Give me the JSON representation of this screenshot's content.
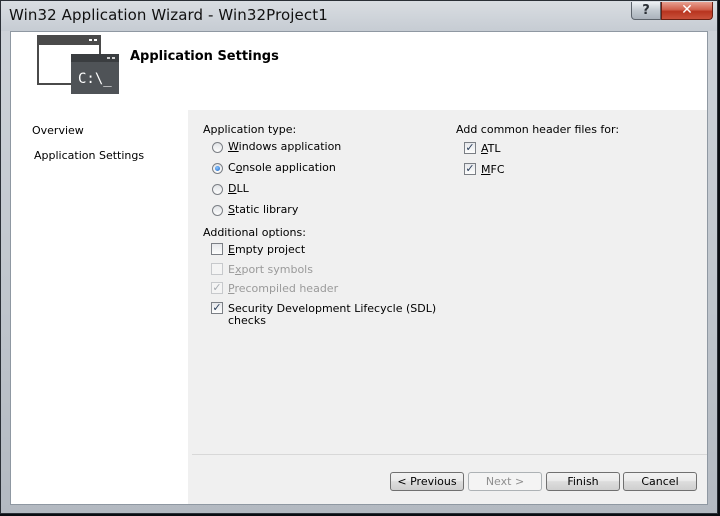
{
  "window": {
    "title": "Win32 Application Wizard - Win32Project1",
    "help_label": "?",
    "close_label": "✕"
  },
  "header": {
    "title": "Application Settings",
    "icon": "console-window-icon",
    "icon_text": "C:\\_"
  },
  "sidebar": {
    "items": [
      {
        "label": "Overview",
        "selected": false
      },
      {
        "label": "Application Settings",
        "selected": true
      }
    ]
  },
  "application_type": {
    "label": "Application type:",
    "options": [
      {
        "label": "Windows application",
        "selected": false
      },
      {
        "label": "Console application",
        "selected": true
      },
      {
        "label": "DLL",
        "selected": false
      },
      {
        "label": "Static library",
        "selected": false
      }
    ]
  },
  "additional_options": {
    "label": "Additional options:",
    "options": [
      {
        "label": "Empty project",
        "checked": false,
        "enabled": true
      },
      {
        "label": "Export symbols",
        "checked": false,
        "enabled": false
      },
      {
        "label": "Precompiled header",
        "checked": true,
        "enabled": false
      },
      {
        "label_line1": "Security Development Lifecycle (SDL)",
        "label_line2": "checks",
        "checked": true,
        "enabled": true
      }
    ]
  },
  "common_headers": {
    "label": "Add common header files for:",
    "options": [
      {
        "label": "ATL",
        "checked": true
      },
      {
        "label": "MFC",
        "checked": true
      }
    ]
  },
  "buttons": {
    "previous": "< Previous",
    "next": "Next >",
    "finish": "Finish",
    "cancel": "Cancel"
  },
  "colors": {
    "accent": "#1b64c8",
    "close_button": "#c9513b"
  }
}
